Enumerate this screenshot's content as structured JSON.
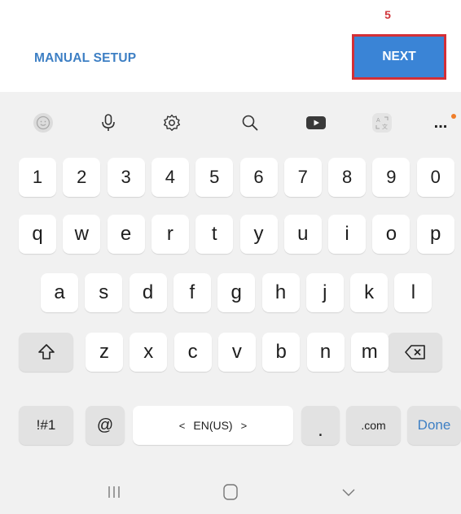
{
  "annotation": {
    "step_number": "5",
    "highlight_color": "#d32f36"
  },
  "header": {
    "manual_setup_label": "MANUAL SETUP",
    "next_label": "NEXT",
    "accent_color": "#3a84d6"
  },
  "keyboard": {
    "toolbar": {
      "icons": [
        "emoji-icon",
        "microphone-icon",
        "settings-icon",
        "search-icon",
        "youtube-icon",
        "translate-icon",
        "more-icon"
      ],
      "more_label": "..."
    },
    "number_row": [
      "1",
      "2",
      "3",
      "4",
      "5",
      "6",
      "7",
      "8",
      "9",
      "0"
    ],
    "row1": [
      "q",
      "w",
      "e",
      "r",
      "t",
      "y",
      "u",
      "i",
      "o",
      "p"
    ],
    "row2": [
      "a",
      "s",
      "d",
      "f",
      "g",
      "h",
      "j",
      "k",
      "l"
    ],
    "row3": [
      "z",
      "x",
      "c",
      "v",
      "b",
      "n",
      "m"
    ],
    "bottom": {
      "symbols_label": "!#1",
      "at_label": "@",
      "language_label": "EN(US)",
      "lang_left": "<",
      "lang_right": ">",
      "period_label": ".",
      "com_label": ".com",
      "done_label": "Done"
    }
  },
  "navigation": {
    "icons": [
      "recent-apps-icon",
      "home-icon",
      "back-icon"
    ]
  }
}
